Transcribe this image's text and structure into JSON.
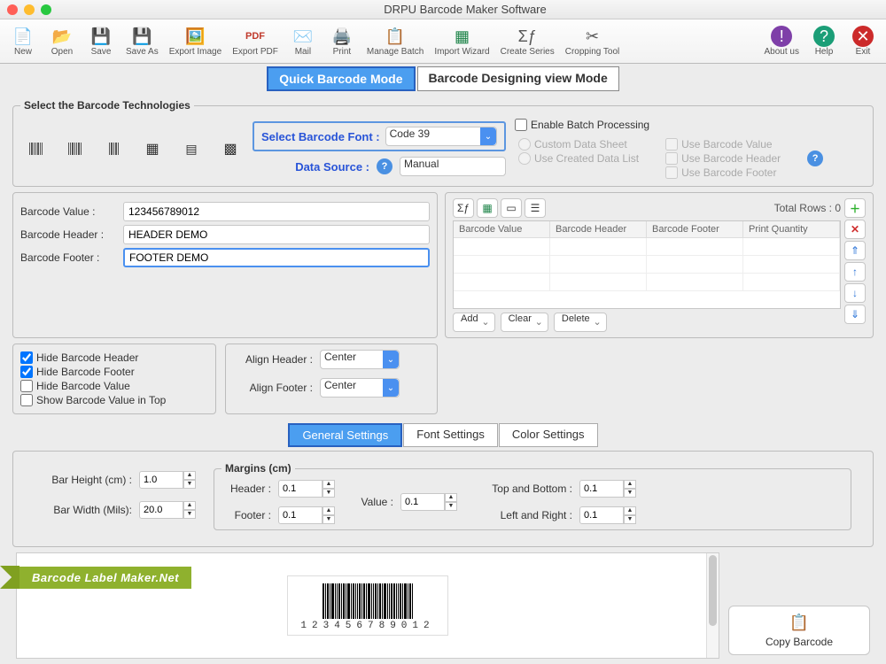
{
  "window": {
    "title": "DRPU Barcode Maker Software"
  },
  "toolbar": {
    "new": "New",
    "open": "Open",
    "save": "Save",
    "saveas": "Save As",
    "export_img": "Export Image",
    "export_pdf": "Export PDF",
    "mail": "Mail",
    "print": "Print",
    "manage_batch": "Manage Batch",
    "import_wizard": "Import Wizard",
    "create_series": "Create Series",
    "cropping": "Cropping Tool",
    "about": "About us",
    "help": "Help",
    "exit": "Exit"
  },
  "modes": {
    "quick": "Quick Barcode Mode",
    "design": "Barcode Designing view Mode"
  },
  "tech_legend": "Select the Barcode Technologies",
  "font_label": "Select Barcode Font :",
  "font_value": "Code 39",
  "data_source_label": "Data Source :",
  "data_source_value": "Manual",
  "batch": {
    "enable": "Enable Batch Processing",
    "custom": "Custom Data Sheet",
    "created": "Use Created Data List",
    "use_value": "Use Barcode Value",
    "use_header": "Use Barcode Header",
    "use_footer": "Use Barcode Footer"
  },
  "values": {
    "value_label": "Barcode Value :",
    "value": "123456789012",
    "header_label": "Barcode Header :",
    "header": "HEADER DEMO",
    "footer_label": "Barcode Footer :",
    "footer": "FOOTER DEMO"
  },
  "list": {
    "total_label": "Total Rows : 0",
    "cols": {
      "c1": "Barcode Value",
      "c2": "Barcode Header",
      "c3": "Barcode Footer",
      "c4": "Print Quantity"
    },
    "ops": {
      "add": "Add",
      "clear": "Clear",
      "delete": "Delete"
    }
  },
  "hide": {
    "header": "Hide Barcode Header",
    "footer": "Hide Barcode Footer",
    "value": "Hide Barcode Value",
    "top": "Show Barcode Value in Top"
  },
  "align": {
    "header_label": "Align Header :",
    "header_value": "Center",
    "footer_label": "Align Footer :",
    "footer_value": "Center"
  },
  "tabs": {
    "general": "General Settings",
    "font": "Font Settings",
    "color": "Color Settings"
  },
  "settings": {
    "bar_h_label": "Bar Height (cm) :",
    "bar_h": "1.0",
    "bar_w_label": "Bar Width (Mils):",
    "bar_w": "20.0",
    "margins_legend": "Margins (cm)",
    "m_header_label": "Header :",
    "m_header": "0.1",
    "m_footer_label": "Footer :",
    "m_footer": "0.1",
    "m_value_label": "Value :",
    "m_value": "0.1",
    "m_tb_label": "Top and Bottom :",
    "m_tb": "0.1",
    "m_lr_label": "Left and Right :",
    "m_lr": "0.1"
  },
  "preview_text": "123456789012",
  "copy": "Copy Barcode",
  "ribbon": "Barcode Label Maker.Net"
}
